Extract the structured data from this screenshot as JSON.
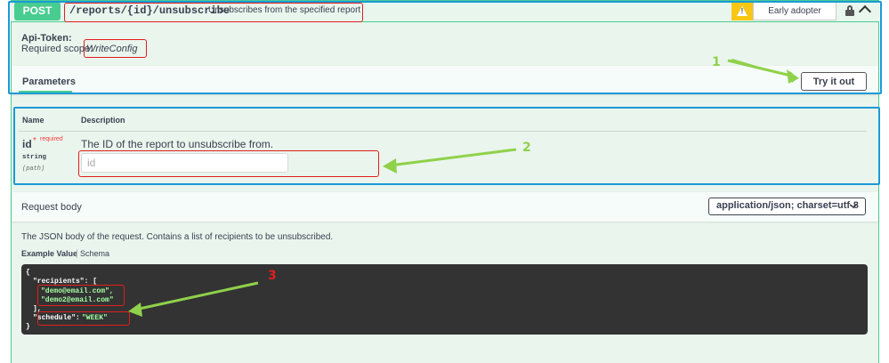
{
  "operation": {
    "method": "POST",
    "path": "/reports/{id}/unsubscribe",
    "summary": "Unsubscribes from the specified report",
    "badge": "Early adopter",
    "badge_icon": "warning-icon",
    "lock_icon": "lock-icon",
    "collapse_icon": "chevron-up-icon"
  },
  "auth": {
    "title": "Api-Token:",
    "scope_label": "Required scope:",
    "scope": "WriteConfig"
  },
  "parameters": {
    "tab_label": "Parameters",
    "try_label": "Try it out",
    "col_name": "Name",
    "col_description": "Description",
    "rows": [
      {
        "name": "id",
        "required_mark": "*",
        "required_text": "required",
        "type": "string",
        "location": "(path)",
        "description": "The ID of the report to unsubscribe from.",
        "placeholder": "id"
      }
    ]
  },
  "request_body": {
    "title": "Request body",
    "content_type": "application/json; charset=utf-8",
    "description": "The JSON body of the request. Contains a list of recipients to be unsubscribed.",
    "example_tab": "Example Value",
    "schema_tab": "Schema",
    "code": {
      "open": "{",
      "recipients_key": "\"recipients\": [",
      "recipient_1": "\"demo@email.com\",",
      "recipient_2": "\"demo2@email.com\"",
      "array_close": "],",
      "schedule_key": "\"schedule\": ",
      "schedule_value": "\"WEEK\"",
      "close": "}"
    }
  },
  "annotations": {
    "label_1": "1",
    "label_2": "2",
    "label_3": "3"
  },
  "colors": {
    "post_method": "#49cc90",
    "annotation_blue": "#1b9ad6",
    "annotation_red": "#e31e1e",
    "annotation_green": "#8fd14a",
    "code_string": "#a2fca2"
  }
}
